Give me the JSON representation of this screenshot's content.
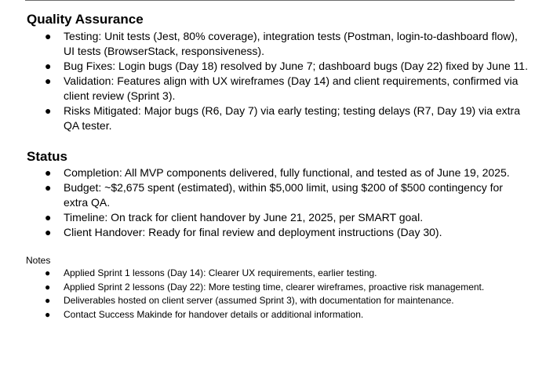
{
  "quality_assurance": {
    "heading": "Quality Assurance",
    "items": [
      "Testing: Unit tests (Jest, 80% coverage), integration tests (Postman, login-to-dashboard flow), UI tests (BrowserStack, responsiveness).",
      "Bug Fixes: Login bugs (Day 18) resolved by June 7; dashboard bugs (Day 22) fixed by June 11.",
      "Validation: Features align with UX wireframes (Day 14) and client requirements, confirmed via client review (Sprint 3).",
      "Risks Mitigated: Major bugs (R6, Day 7) via early testing; testing delays (R7, Day 19) via extra QA tester."
    ]
  },
  "status": {
    "heading": "Status",
    "items": [
      "Completion: All MVP components delivered, fully functional, and tested as of June 19, 2025.",
      "Budget: ~$2,675 spent (estimated), within $5,000 limit, using $200 of $500 contingency for extra QA.",
      "Timeline: On track for client handover by June 21, 2025, per SMART goal.",
      "Client Handover: Ready for final review and deployment instructions (Day 30)."
    ]
  },
  "notes": {
    "heading": "Notes",
    "items": [
      "Applied Sprint 1 lessons (Day 14): Clearer UX requirements, earlier testing.",
      "Applied Sprint 2 lessons (Day 22): More testing time, clearer wireframes, proactive risk management.",
      "Deliverables hosted on client server (assumed Sprint 3), with documentation for maintenance.",
      "Contact Success Makinde for handover details or additional information."
    ]
  },
  "bullet_glyph": "●"
}
